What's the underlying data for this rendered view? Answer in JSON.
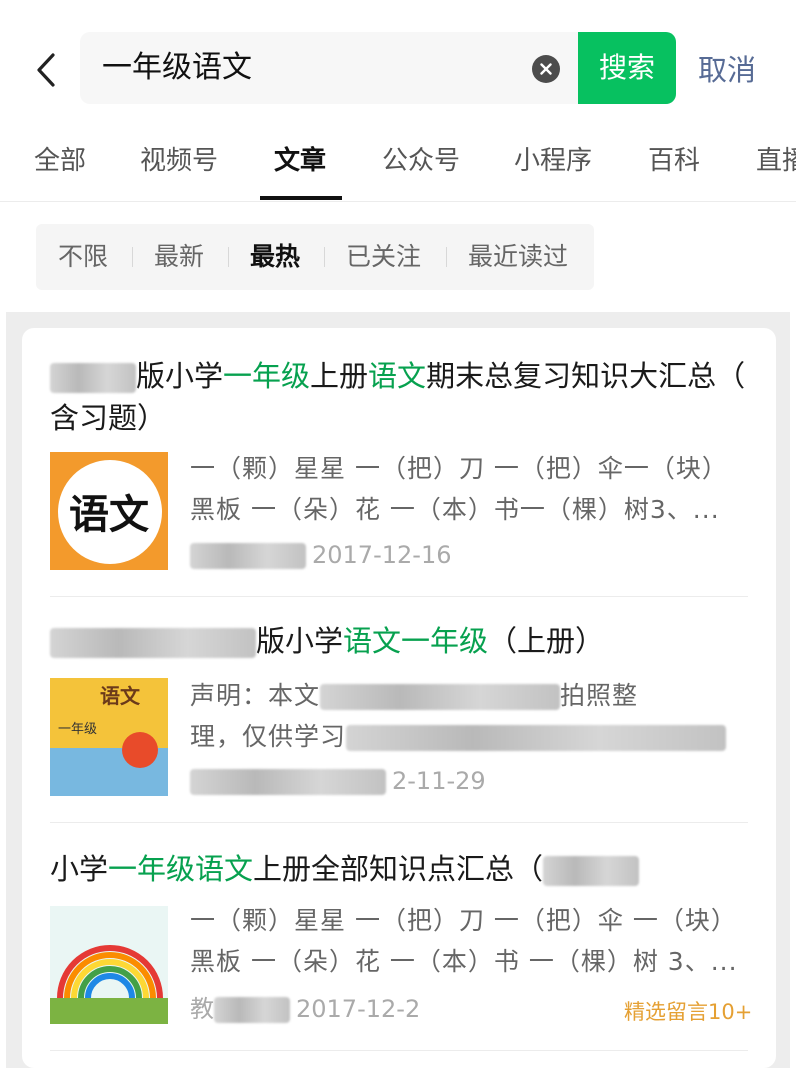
{
  "search": {
    "query": "一年级语文",
    "button_label": "搜索",
    "cancel_label": "取消"
  },
  "tabs": [
    {
      "label": "全部"
    },
    {
      "label": "视频号"
    },
    {
      "label": "文章",
      "active": true
    },
    {
      "label": "公众号"
    },
    {
      "label": "小程序"
    },
    {
      "label": "百科"
    },
    {
      "label": "直播"
    }
  ],
  "filters": [
    {
      "label": "不限"
    },
    {
      "label": "最新"
    },
    {
      "label": "最热",
      "active": true
    },
    {
      "label": "已关注"
    },
    {
      "label": "最近读过"
    }
  ],
  "results": [
    {
      "title_parts": [
        "版小学",
        "一年级",
        "上册",
        "语文",
        "期末总复习知识大汇总（"
      ],
      "title_line2": "含习题）",
      "summary_line1": "一（颗）星星 一（把）刀 一（把）伞一（块）",
      "summary_line2": "黑板 一（朵）花 一（本）书一（棵）树3、...",
      "date": "2017-12-16",
      "thumb_text": "语文"
    },
    {
      "title_parts": [
        "版小学",
        "语文一年级",
        "（上册）"
      ],
      "summary_line1": "声明：本文",
      "summary_line1_tail": "拍照整",
      "summary_line2": "理，仅供学习",
      "date": "2-11-29",
      "thumb_text": "语文",
      "thumb_sub": "一年级"
    },
    {
      "title_parts": [
        "小学",
        "一年级语文",
        "上册全部知识点汇总（"
      ],
      "summary_line1": "一（颗）星星 一（把）刀 一（把）伞 一（块）",
      "summary_line2": "黑板 一（朵）花 一（本）书 一（棵）树 3、...",
      "date": "2017-12-2",
      "meta_prefix": "教",
      "badge": "精选留言10+"
    }
  ],
  "colors": {
    "accent_green": "#07c160",
    "highlight_green": "#07a14f",
    "link_blue": "#576b95",
    "badge_orange": "#e5a033"
  }
}
